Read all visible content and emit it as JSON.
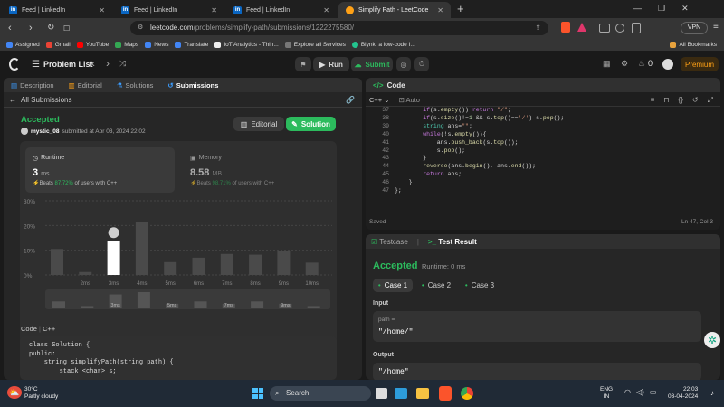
{
  "browser": {
    "tabs": [
      {
        "label": "Feed | LinkedIn"
      },
      {
        "label": "Feed | LinkedIn"
      },
      {
        "label": "Feed | LinkedIn"
      },
      {
        "label": "Simplify Path - LeetCode"
      }
    ],
    "url_domain": "leetcode.com",
    "url_path": "/problems/simplify-path/submissions/1222275580/",
    "vpn_label": "VPN",
    "bookmarks": [
      "Assigned",
      "Gmail",
      "YouTube",
      "Maps",
      "News",
      "Translate",
      "IoT Analytics - Thin...",
      "Explore all Services",
      "Blynk: a low-code I..."
    ],
    "all_bookmarks": "All Bookmarks"
  },
  "lc": {
    "problem_list": "Problem List",
    "run": "Run",
    "submit": "Submit",
    "streak": "0",
    "premium": "Premium"
  },
  "left": {
    "tabs": [
      "Description",
      "Editorial",
      "Solutions",
      "Submissions"
    ],
    "all_submissions": "All Submissions",
    "status": "Accepted",
    "user": "mystic_08",
    "submitted_text": "submitted at Apr 03, 2024 22:02",
    "editorial_btn": "Editorial",
    "solution_btn": "Solution",
    "runtime": {
      "label": "Runtime",
      "value": "3",
      "unit": "ms",
      "beats_word": "Beats",
      "beats_pct": "87.72%",
      "beats_suffix": "of users with C++"
    },
    "memory": {
      "label": "Memory",
      "value": "8.58",
      "unit": "MB",
      "beats_word": "Beats",
      "beats_pct": "98.71%",
      "beats_suffix": "of users with C++"
    },
    "code_label": "Code",
    "code_lang": "C++",
    "code_lines": [
      "class Solution {",
      "public:",
      "    string simplifyPath(string path) {",
      "        stack <char> s;"
    ]
  },
  "chart_data": {
    "type": "bar",
    "yticks": [
      "30%",
      "20%",
      "10%",
      "0%"
    ],
    "ylim": [
      0,
      30
    ],
    "categories": [
      "",
      "2ms",
      "3ms",
      "4ms",
      "5ms",
      "6ms",
      "7ms",
      "8ms",
      "9ms",
      "10ms"
    ],
    "values": [
      10.5,
      1.2,
      13.8,
      21.5,
      5.2,
      7,
      8.5,
      8.2,
      9.8,
      5
    ],
    "highlight_index": 2,
    "mini_labels": [
      "3ms",
      "5ms",
      "7ms",
      "9ms"
    ],
    "mini_values": [
      3,
      1,
      6,
      7,
      2,
      3,
      2,
      3,
      2,
      1
    ]
  },
  "code": {
    "title": "Code",
    "lang": "C++",
    "mode": "Auto",
    "line_numbers": [
      "37",
      "38",
      "39",
      "40",
      "41",
      "42",
      "43",
      "44",
      "45",
      "46",
      "47"
    ],
    "saved": "Saved",
    "cursor": "Ln 47, Col 3"
  },
  "test": {
    "tab1": "Testcase",
    "tab2": "Test Result",
    "status": "Accepted",
    "runtime": "Runtime: 0 ms",
    "cases": [
      "Case 1",
      "Case 2",
      "Case 3"
    ],
    "input_label": "Input",
    "param": "path =",
    "input_value": "\"/home/\"",
    "output_label": "Output",
    "output_value": "\"/home\""
  },
  "taskbar": {
    "weather_temp": "30°C",
    "weather_desc": "Partly cloudy",
    "search": "Search",
    "lang1": "ENG",
    "lang2": "IN",
    "time": "22:03",
    "date": "03-04-2024"
  }
}
